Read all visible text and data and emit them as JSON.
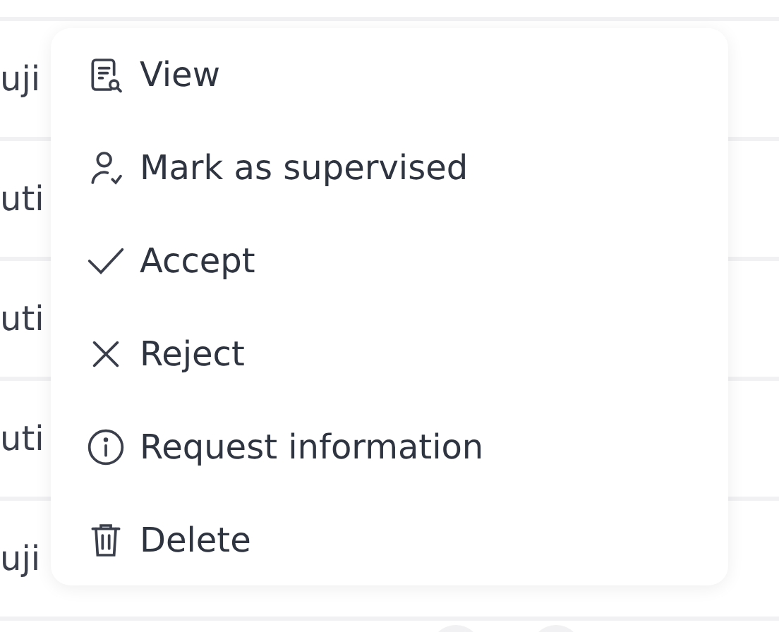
{
  "rows": [
    {
      "cell": "uji"
    },
    {
      "cell": "uti"
    },
    {
      "cell": "uti"
    },
    {
      "cell": "uti"
    },
    {
      "cell": "uji"
    }
  ],
  "menu": {
    "items": [
      {
        "kind": "view",
        "label": "View"
      },
      {
        "kind": "supervise",
        "label": "Mark as supervised"
      },
      {
        "kind": "accept",
        "label": "Accept"
      },
      {
        "kind": "reject",
        "label": "Reject"
      },
      {
        "kind": "info",
        "label": "Request information"
      },
      {
        "kind": "delete",
        "label": "Delete"
      }
    ]
  }
}
